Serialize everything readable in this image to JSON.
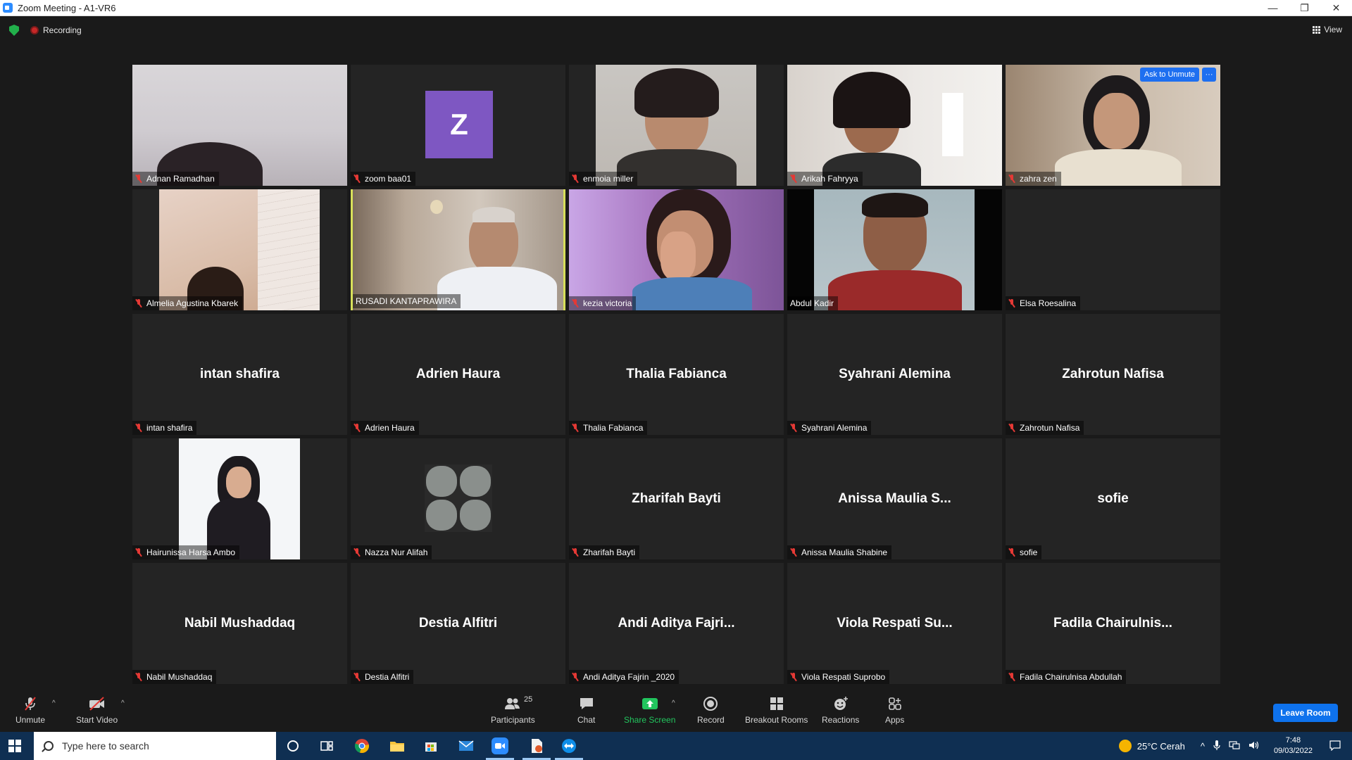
{
  "window": {
    "title": "Zoom Meeting - A1-VR6"
  },
  "topbar": {
    "recording_label": "Recording",
    "view_label": "View"
  },
  "tiles": [
    {
      "name": "Adnan Ramadhan",
      "type": "video",
      "muted": true
    },
    {
      "name": "zoom baa01",
      "type": "avatar",
      "initial": "Z",
      "muted": true
    },
    {
      "name": "enmoia miller",
      "type": "video",
      "muted": true
    },
    {
      "name": "Arikah Fahryya",
      "type": "video",
      "muted": true
    },
    {
      "name": "zahra zen",
      "type": "video",
      "muted": true,
      "ask_to_unmute": "Ask to Unmute",
      "more": "···"
    },
    {
      "name": "Almelia Agustina Kbarek",
      "type": "video",
      "muted": true
    },
    {
      "name": "RUSADI KANTAPRAWIRA",
      "type": "video",
      "muted": false,
      "active_speaker": true
    },
    {
      "name": "kezia victoria",
      "type": "video",
      "muted": true
    },
    {
      "name": "Abdul Kadir",
      "type": "video",
      "muted": false
    },
    {
      "name": "Elsa Roesalina",
      "type": "blank",
      "muted": true
    },
    {
      "name": "intan shafira",
      "display": "intan shafira",
      "type": "name",
      "muted": true
    },
    {
      "name": "Adrien Haura",
      "display": "Adrien Haura",
      "type": "name",
      "muted": true
    },
    {
      "name": "Thalia Fabianca",
      "display": "Thalia Fabianca",
      "type": "name",
      "muted": true
    },
    {
      "name": "Syahrani Alemina",
      "display": "Syahrani Alemina",
      "type": "name",
      "muted": true
    },
    {
      "name": "Zahrotun Nafisa",
      "display": "Zahrotun Nafisa",
      "type": "name",
      "muted": true
    },
    {
      "name": "Hairunissa Harsa Ambo",
      "type": "video",
      "muted": true
    },
    {
      "name": "Nazza Nur Alifah",
      "type": "video",
      "muted": true
    },
    {
      "name": "Zharifah Bayti",
      "display": "Zharifah Bayti",
      "type": "name",
      "muted": true
    },
    {
      "name": "Anissa Maulia Shabine",
      "display": "Anissa  Maulia  S...",
      "type": "name",
      "muted": true
    },
    {
      "name": "sofie",
      "display": "sofie",
      "type": "name",
      "muted": true
    },
    {
      "name": "Nabil Mushaddaq",
      "display": "Nabil Mushaddaq",
      "type": "name",
      "muted": true
    },
    {
      "name": "Destia Alfitri",
      "display": "Destia Alfitri",
      "type": "name",
      "muted": true
    },
    {
      "name": "Andi Aditya Fajrin _2020",
      "display": "Andi Aditya Fajri...",
      "type": "name",
      "muted": true
    },
    {
      "name": "Viola Respati Suprobo",
      "display": "Viola Respati Su...",
      "type": "name",
      "muted": true
    },
    {
      "name": "Fadila Chairulnisa Abdullah",
      "display": "Fadila  Chairulnis...",
      "type": "name",
      "muted": true
    }
  ],
  "toolbar": {
    "unmute": "Unmute",
    "start_video": "Start Video",
    "participants": "Participants",
    "participants_count": "25",
    "chat": "Chat",
    "share_screen": "Share Screen",
    "record": "Record",
    "breakout_rooms": "Breakout Rooms",
    "reactions": "Reactions",
    "apps": "Apps",
    "leave": "Leave Room"
  },
  "taskbar": {
    "search_placeholder": "Type here to search",
    "weather": "25°C  Cerah",
    "time": "7:48",
    "date": "09/03/2022"
  },
  "colors": {
    "accent": "#0e72ed",
    "active_speaker": "#d8e05a",
    "muted": "#e53935",
    "share": "#22c55e"
  }
}
